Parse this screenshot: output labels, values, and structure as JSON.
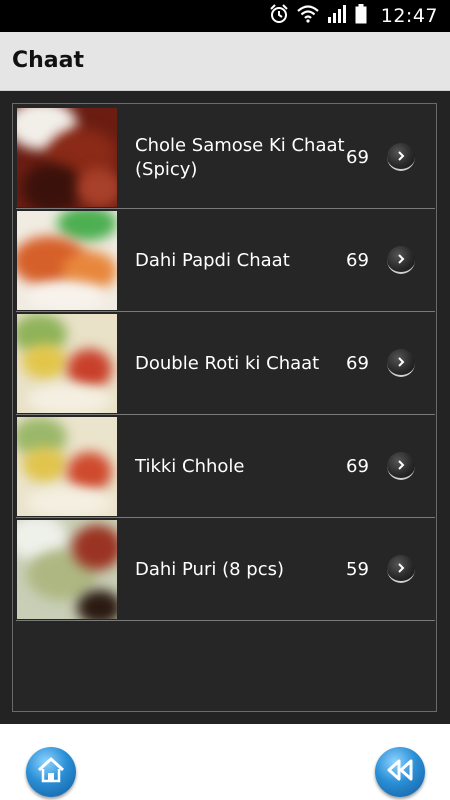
{
  "status_bar": {
    "time": "12:47",
    "icons": [
      "alarm-icon",
      "wifi-icon",
      "signal-icon",
      "battery-icon"
    ]
  },
  "header": {
    "title": "Chaat"
  },
  "menu": {
    "items": [
      {
        "name": "Chole Samose Ki Chaat (Spicy)",
        "price": "69",
        "thumb": "chole-samose-image"
      },
      {
        "name": "Dahi Papdi Chaat",
        "price": "69",
        "thumb": "dahi-papdi-image"
      },
      {
        "name": "Double Roti ki Chaat",
        "price": "69",
        "thumb": "double-roti-image"
      },
      {
        "name": "Tikki Chhole",
        "price": "69",
        "thumb": "tikki-chhole-image"
      },
      {
        "name": "Dahi Puri (8 pcs)",
        "price": "59",
        "thumb": "dahi-puri-image"
      }
    ]
  },
  "bottom_nav": {
    "home_icon": "home-icon",
    "back_icon": "rewind-icon"
  },
  "colors": {
    "header_bg": "#e5e5e5",
    "list_bg": "#262626",
    "accent_button": "#2a8fd6"
  }
}
